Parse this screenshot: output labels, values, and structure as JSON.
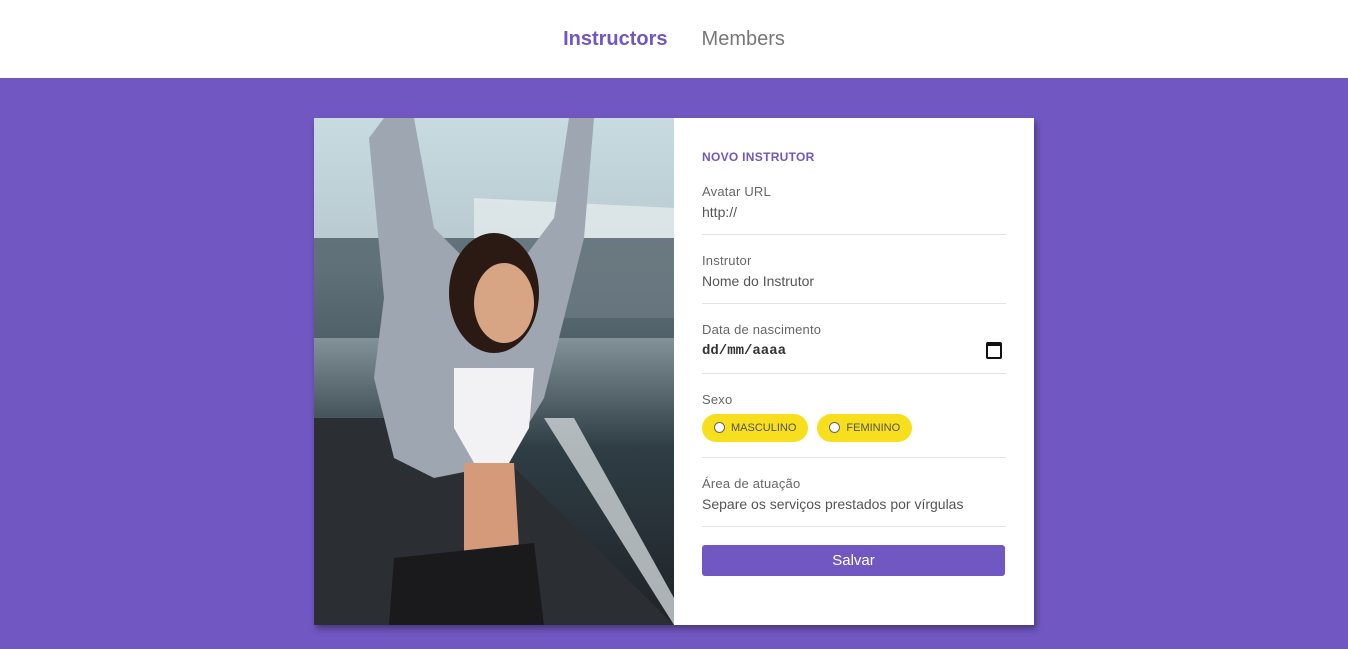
{
  "nav": {
    "items": [
      {
        "label": "Instructors",
        "active": true
      },
      {
        "label": "Members",
        "active": false
      }
    ]
  },
  "form": {
    "title": "NOVO INSTRUTOR",
    "avatar": {
      "label": "Avatar URL",
      "placeholder": "http://"
    },
    "name": {
      "label": "Instrutor",
      "placeholder": "Nome do Instrutor"
    },
    "birth": {
      "label": "Data de nascimento",
      "value": "dd/mm/aaaa"
    },
    "gender": {
      "label": "Sexo",
      "options": [
        "MASCULINO",
        "FEMININO"
      ]
    },
    "services": {
      "label": "Área de atuação",
      "placeholder": "Separe os serviços prestados por vírgulas"
    },
    "save_label": "Salvar"
  },
  "colors": {
    "accent": "#7157c1",
    "pill": "#f7df1e"
  }
}
